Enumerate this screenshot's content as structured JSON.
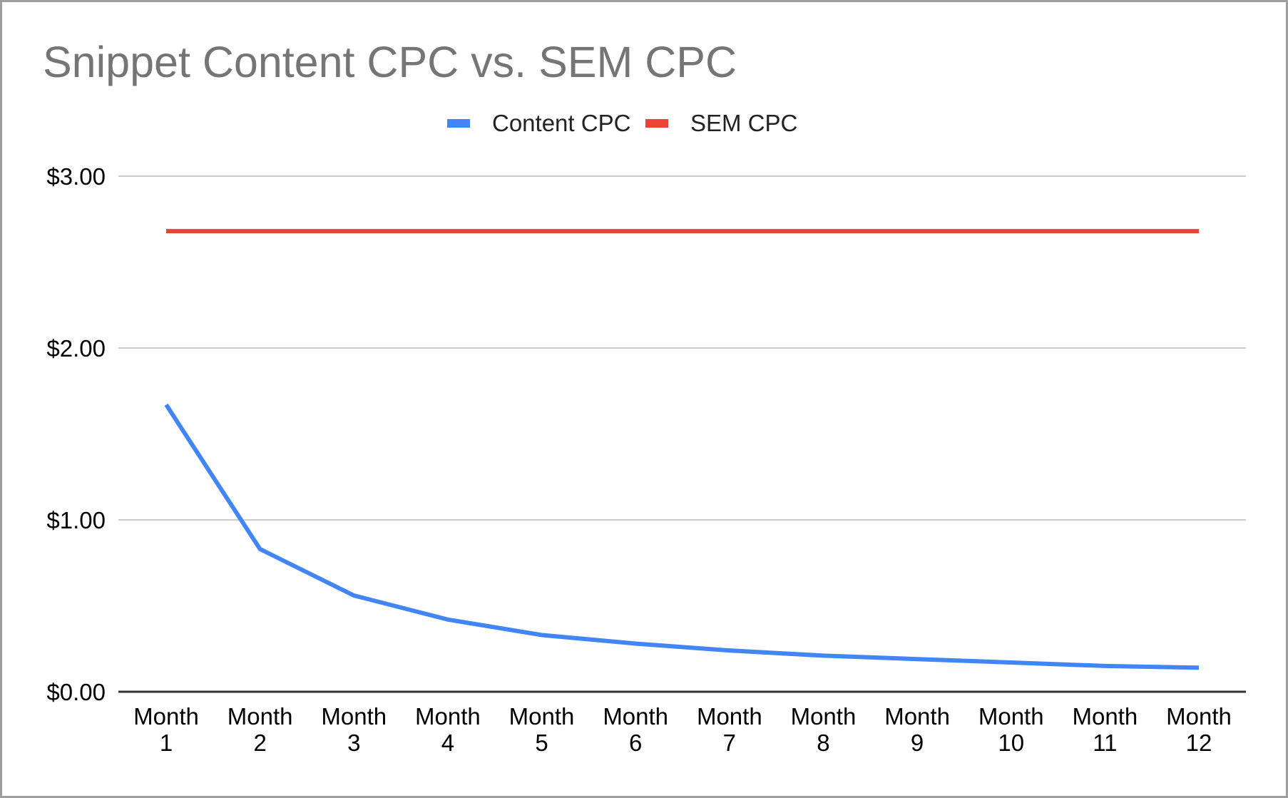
{
  "chart_data": {
    "type": "line",
    "title": "Snippet Content CPC vs. SEM CPC",
    "xlabel": "",
    "ylabel": "",
    "categories": [
      [
        "Month",
        "1"
      ],
      [
        "Month",
        "2"
      ],
      [
        "Month",
        "3"
      ],
      [
        "Month",
        "4"
      ],
      [
        "Month",
        "5"
      ],
      [
        "Month",
        "6"
      ],
      [
        "Month",
        "7"
      ],
      [
        "Month",
        "8"
      ],
      [
        "Month",
        "9"
      ],
      [
        "Month",
        "10"
      ],
      [
        "Month",
        "11"
      ],
      [
        "Month",
        "12"
      ]
    ],
    "series": [
      {
        "name": "Content CPC",
        "color": "#4285f4",
        "values": [
          1.67,
          0.83,
          0.56,
          0.42,
          0.33,
          0.28,
          0.24,
          0.21,
          0.19,
          0.17,
          0.15,
          0.14
        ]
      },
      {
        "name": "SEM CPC",
        "color": "#ea4335",
        "values": [
          2.68,
          2.68,
          2.68,
          2.68,
          2.68,
          2.68,
          2.68,
          2.68,
          2.68,
          2.68,
          2.68,
          2.68
        ]
      }
    ],
    "ylim": [
      0,
      3
    ],
    "yticks": [
      0,
      1,
      2,
      3
    ],
    "ytick_labels": [
      "$0.00",
      "$1.00",
      "$2.00",
      "$3.00"
    ],
    "grid": true,
    "legend_position": "top-center"
  },
  "legend": {
    "items": [
      {
        "label": "Content CPC",
        "color": "#4285f4"
      },
      {
        "label": "SEM CPC",
        "color": "#ea4335"
      }
    ]
  }
}
